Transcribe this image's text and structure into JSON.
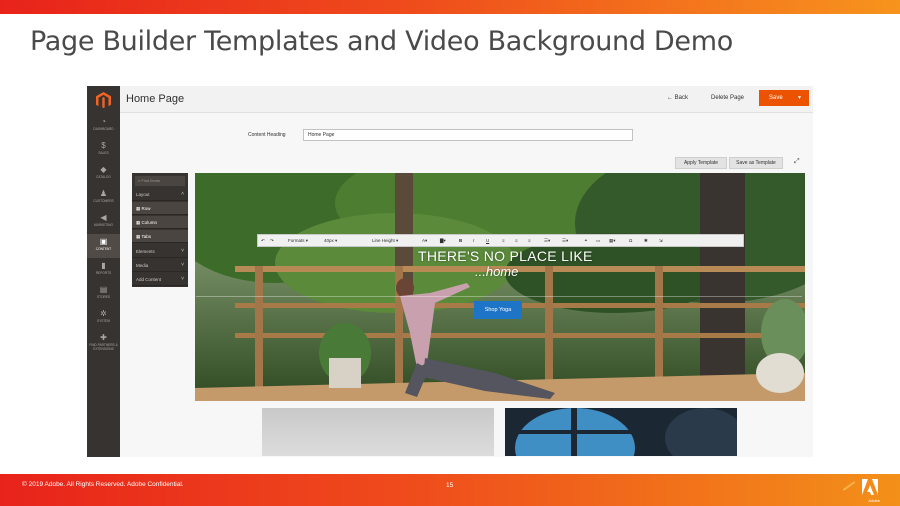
{
  "slide": {
    "title": "Page Builder Templates and Video Background Demo",
    "footer": "© 2019 Adobe.  All Rights Reserved.  Adobe Confidential.",
    "page_number": "15",
    "brand": "Adobe"
  },
  "colors": {
    "accent_red": "#e8231b",
    "accent_orange": "#f7941d",
    "admin_save": "#eb5202",
    "sidebar": "#373330",
    "shop_button": "#1e74c7"
  },
  "admin": {
    "sidebar": [
      {
        "label": "Dashboard",
        "icon": "speedometer-icon"
      },
      {
        "label": "Sales",
        "icon": "dollar-icon"
      },
      {
        "label": "Catalog",
        "icon": "cube-icon"
      },
      {
        "label": "Customers",
        "icon": "person-icon"
      },
      {
        "label": "Marketing",
        "icon": "megaphone-icon"
      },
      {
        "label": "Content",
        "icon": "layout-icon"
      },
      {
        "label": "Reports",
        "icon": "bar-chart-icon"
      },
      {
        "label": "Stores",
        "icon": "store-icon"
      },
      {
        "label": "System",
        "icon": "gear-icon"
      },
      {
        "label": "Find Partners & Extensions",
        "icon": "puzzle-icon"
      }
    ],
    "header": {
      "title": "Home Page",
      "back": "Back",
      "delete": "Delete Page",
      "save": "Save"
    },
    "content_heading": {
      "label": "Content Heading",
      "value": "Home Page"
    },
    "template_buttons": {
      "apply": "Apply Template",
      "save_as": "Save as Template"
    },
    "panel": {
      "search_placeholder": "Find Items",
      "group": "Layout",
      "items": [
        "Row",
        "Column",
        "Tabs"
      ],
      "groups": [
        "Elements",
        "Media",
        "Add Content"
      ]
    },
    "editor_toolbar": {
      "formats": "Formats",
      "font_size": "40px",
      "line_height": "Line Height"
    },
    "hero": {
      "line1": "THERE'S NO PLACE LIKE",
      "line2": "...home",
      "button": "Shop Yoga"
    }
  }
}
